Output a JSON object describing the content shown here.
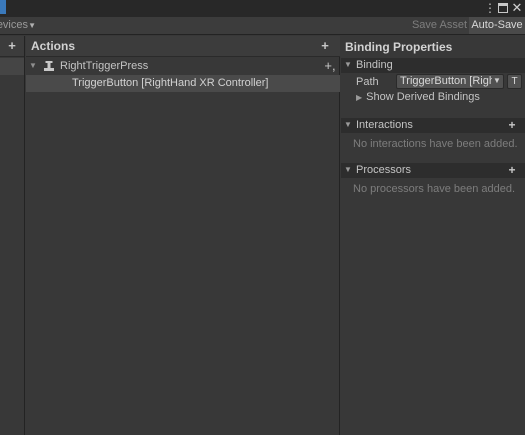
{
  "toolbar": {
    "devices_label": "Devices",
    "save_asset_label": "Save Asset",
    "auto_save_label": "Auto-Save"
  },
  "actions": {
    "title": "Actions",
    "items": [
      {
        "label": "RightTriggerPress",
        "bindings": [
          "TriggerButton [RightHand XR Controller]"
        ]
      }
    ]
  },
  "binding_properties": {
    "title": "Binding Properties",
    "binding_section": "Binding",
    "path_label": "Path",
    "path_value": "TriggerButton [RightHand XR Controller]",
    "t_button_label": "T",
    "show_derived_label": "Show Derived Bindings",
    "interactions_section": "Interactions",
    "interactions_empty": "No interactions have been added.",
    "processors_section": "Processors",
    "processors_empty": "No processors have been added."
  },
  "icons": {
    "window_menu": "kebab-icon",
    "window_maximize": "maximize-icon",
    "window_close": "close-icon",
    "add": "plus-icon",
    "action_type": "button-action-icon",
    "add_binding": "add-binding-icon",
    "foldout": "triangle-icon"
  },
  "colors": {
    "background": "#383838",
    "header_bar": "#282828",
    "selected_row": "#4a4a4a",
    "section_header": "#2d2d2d",
    "tab_accent": "#3a79bb"
  }
}
